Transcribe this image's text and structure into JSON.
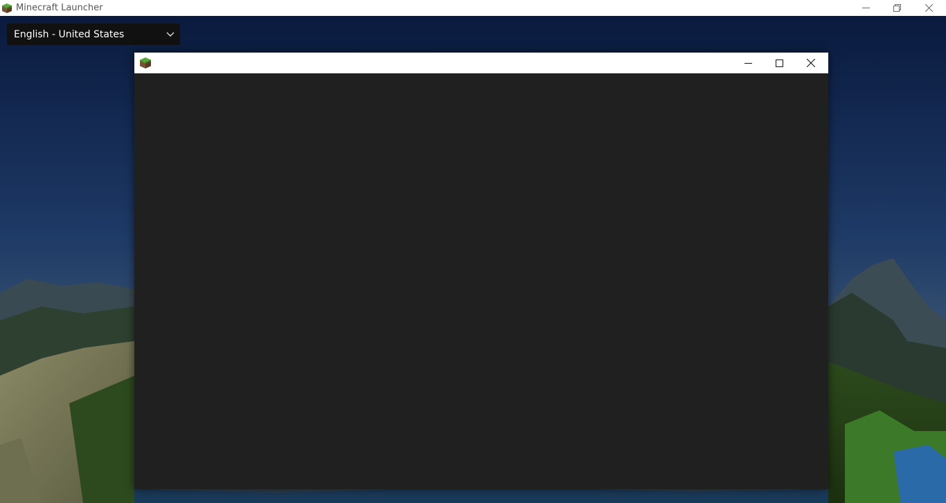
{
  "window": {
    "title": "Minecraft Launcher",
    "controls": [
      "minimize",
      "restore",
      "close"
    ]
  },
  "language_select": {
    "value": "English - United States"
  },
  "dialog": {
    "title": "",
    "controls": [
      "minimize",
      "maximize",
      "close"
    ]
  },
  "colors": {
    "titlebar": "#ffffff",
    "background_sky": "#0c1e44",
    "dropdown_bg": "#111111",
    "dialog_body": "#202020",
    "grass_green": "#4a8a2a",
    "dirt_brown": "#7a5230"
  },
  "icons": {
    "app": "minecraft-grass-block-icon",
    "minimize": "minimize-icon",
    "restore": "restore-icon",
    "maximize": "maximize-icon",
    "close": "close-icon",
    "dropdown": "chevron-down-icon"
  }
}
